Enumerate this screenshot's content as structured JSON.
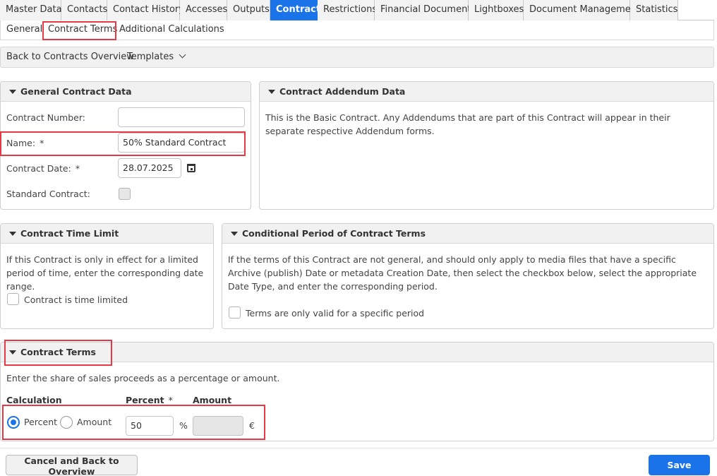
{
  "tabs": [
    {
      "label": "Master Data"
    },
    {
      "label": "Contacts"
    },
    {
      "label": "Contact History"
    },
    {
      "label": "Accesses"
    },
    {
      "label": "Outputs"
    },
    {
      "label": "Contract",
      "active": true
    },
    {
      "label": "Restrictions"
    },
    {
      "label": "Financial Documents"
    },
    {
      "label": "Lightboxes"
    },
    {
      "label": "Document Management"
    },
    {
      "label": "Statistics"
    }
  ],
  "subtabs": {
    "general": "General",
    "contract_terms": "Contract Terms",
    "additional_calculations": "Additional Calculations"
  },
  "toolbar": {
    "back": "Back to Contracts Overview",
    "templates": "Templates"
  },
  "general_data": {
    "title": "General Contract Data",
    "contract_number_label": "Contract Number:",
    "contract_number_value": "",
    "name_label": "Name:",
    "name_required": "*",
    "name_value": "50% Standard Contract",
    "date_label": "Contract Date:",
    "date_required": "*",
    "date_value": "28.07.2025",
    "standard_label": "Standard Contract:"
  },
  "addendum": {
    "title": "Contract Addendum Data",
    "text": "This is the Basic Contract. Any Addendums that are part of this Contract will appear in their separate respective Addendum forms."
  },
  "time_limit": {
    "title": "Contract Time Limit",
    "text": "If this Contract is only in effect for a limited period of time, enter the corresponding date range.",
    "checkbox_label": "Contract is time limited"
  },
  "conditional": {
    "title": "Conditional Period of Contract Terms",
    "text": "If the terms of this Contract are not general, and should only apply to media files that have a specific Archive (publish) Date or metadata Creation Date, then select the checkbox below, select the appropriate Date Type, and enter the corresponding period.",
    "checkbox_label": "Terms are only valid for a specific period"
  },
  "terms": {
    "title": "Contract Terms",
    "intro": "Enter the share of sales proceeds as a percentage or amount.",
    "calc_header": "Calculation",
    "percent_header": "Percent",
    "percent_required": "*",
    "amount_header": "Amount",
    "radio_percent": "Percent",
    "radio_amount": "Amount",
    "percent_value": "50",
    "percent_unit": "%",
    "amount_value": "",
    "currency": "€",
    "selected": "Percent"
  },
  "footer": {
    "cancel": "Cancel and Back to Overview",
    "save": "Save"
  },
  "colors": {
    "accent": "#1a73e8",
    "highlight": "#e53945"
  }
}
